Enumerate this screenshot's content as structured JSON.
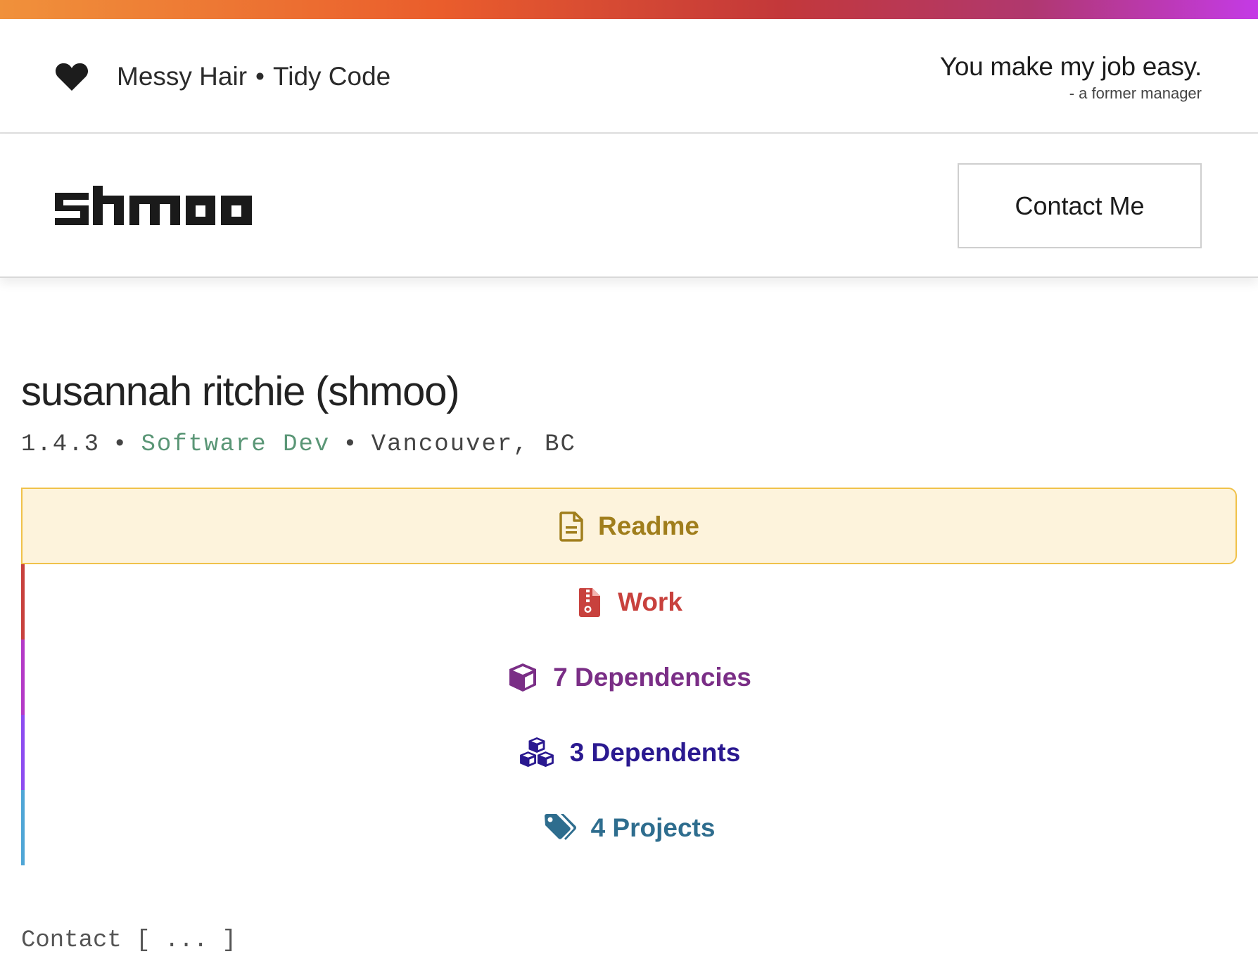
{
  "topbar": {
    "tagline_left": "Messy Hair",
    "tagline_sep": "•",
    "tagline_right": "Tidy Code",
    "quote": "You make my job easy.",
    "quote_attrib": "- a former manager"
  },
  "header": {
    "logo_text": "shmoo",
    "contact_label": "Contact Me"
  },
  "profile": {
    "name": "susannah ritchie (shmoo)",
    "version": "1.4.3",
    "role": "Software Dev",
    "location": "Vancouver, BC",
    "sep": "•"
  },
  "nav": {
    "items": [
      {
        "label": "Readme",
        "color": "#a07e1c",
        "icon": "file-text-icon",
        "active": true
      },
      {
        "label": "Work",
        "color": "#c8413d",
        "icon": "file-archive-icon",
        "bar": "#c8413d"
      },
      {
        "label": "7 Dependencies",
        "color": "#7a2e86",
        "icon": "cube-icon",
        "bar": "#b43ac7"
      },
      {
        "label": "3 Dependents",
        "color": "#2a1990",
        "icon": "cubes-icon",
        "bar": "#8d4cf0"
      },
      {
        "label": "4 Projects",
        "color": "#2e6d8e",
        "icon": "tags-icon",
        "bar": "#4fa6d6"
      }
    ]
  },
  "footer_peek": {
    "label": "Contact [ ... ]"
  },
  "colors": {
    "accent_gradient": [
      "#f0913b",
      "#ea5d2c",
      "#c3383a",
      "#b0386f",
      "#c43ae6"
    ],
    "active_bg": "#fdf3dc",
    "active_border": "#f0c24a"
  }
}
